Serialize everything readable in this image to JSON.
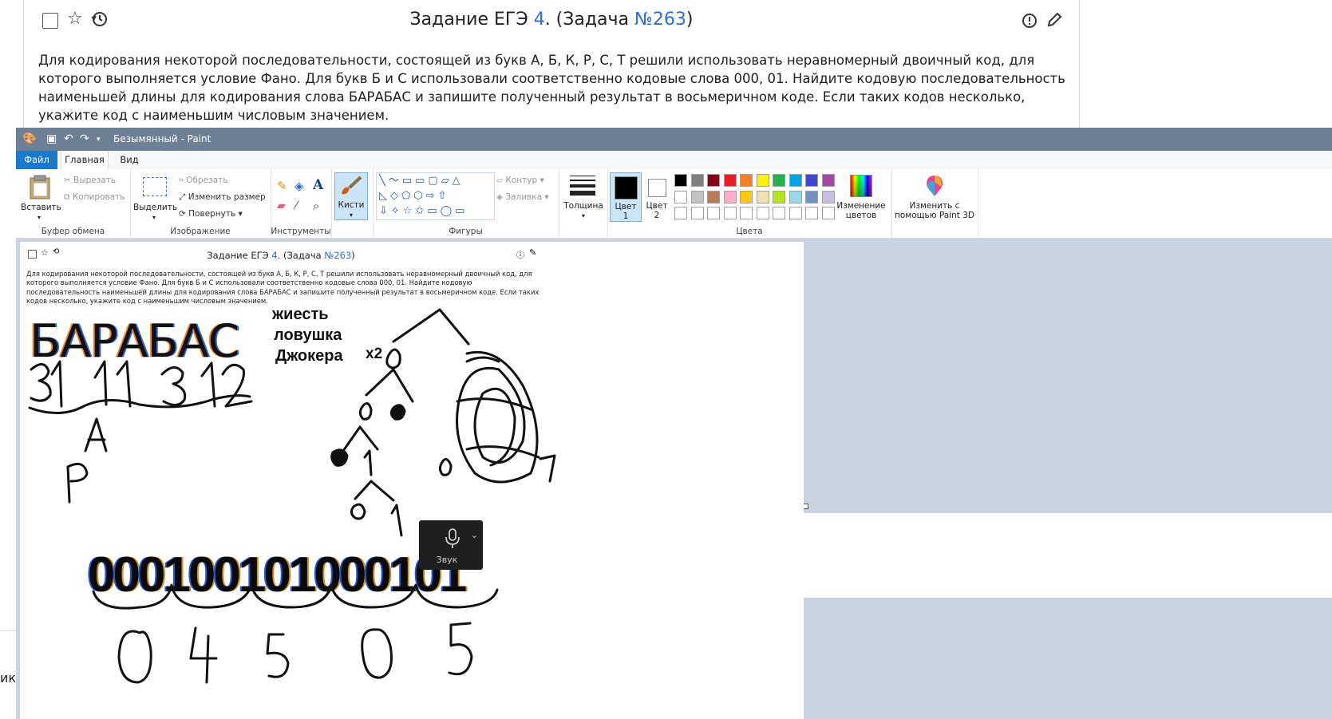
{
  "web": {
    "title_prefix": "Задание ЕГЭ ",
    "title_num": "4",
    "title_mid": ". (Задача ",
    "title_task": "№263",
    "title_end": ")",
    "text": "Для кодирования некоторой последовательности, состоящей из букв А, Б, К, Р, С, Т решили использовать неравномерный двоичный код, для которого выполняется условие Фано. Для букв Б и С использовали соответственно кодовые слова 000, 01. Найдите кодовую последовательность наименьшей длины для кодирования слова БАРАБАС и запишите полученный результат в восьмеричном коде. Если таких кодов несколько, укажите код с наименьшим числовым значением.",
    "left_cut_text": "ик:"
  },
  "paint": {
    "window_title": "Безымянный - Paint",
    "tabs": [
      "Файл",
      "Главная",
      "Вид"
    ],
    "clipboard": {
      "paste": "Вставить",
      "cut": "Вырезать",
      "copy": "Копировать",
      "label": "Буфер обмена"
    },
    "image": {
      "select": "Выделить",
      "crop": "Обрезать",
      "resize": "Изменить размер",
      "rotate": "Повернуть",
      "label": "Изображение"
    },
    "tools": {
      "label": "Инструменты"
    },
    "brushes": {
      "label": "Кисти"
    },
    "shapes": {
      "outline": "Контур",
      "fill": "Заливка",
      "label": "Фигуры"
    },
    "size": {
      "label": "Толщина"
    },
    "colors": {
      "color1": "Цвет",
      "color1_num": "1",
      "color2": "Цвет",
      "color2_num": "2",
      "edit": "Изменение цветов",
      "label": "Цвета",
      "palette_row1": [
        "#000000",
        "#7f7f7f",
        "#880015",
        "#ed1c24",
        "#ff7f27",
        "#fff200",
        "#22b14c",
        "#00a2e8",
        "#3f48cc",
        "#a349a4"
      ],
      "palette_row2": [
        "#ffffff",
        "#c3c3c3",
        "#b97a57",
        "#ffaec9",
        "#ffc90e",
        "#efe4b0",
        "#b5e61d",
        "#99d9ea",
        "#7092be",
        "#c8bfe7"
      ]
    },
    "paint3d": "Изменить с помощью Paint 3D"
  },
  "canvas": {
    "word": "БАРАБАС",
    "note_lines": [
      "жиесть",
      "ловушка",
      "Джокера"
    ],
    "x2": "x2",
    "binary": "000100101000101"
  },
  "mic": {
    "label": "Звук"
  }
}
